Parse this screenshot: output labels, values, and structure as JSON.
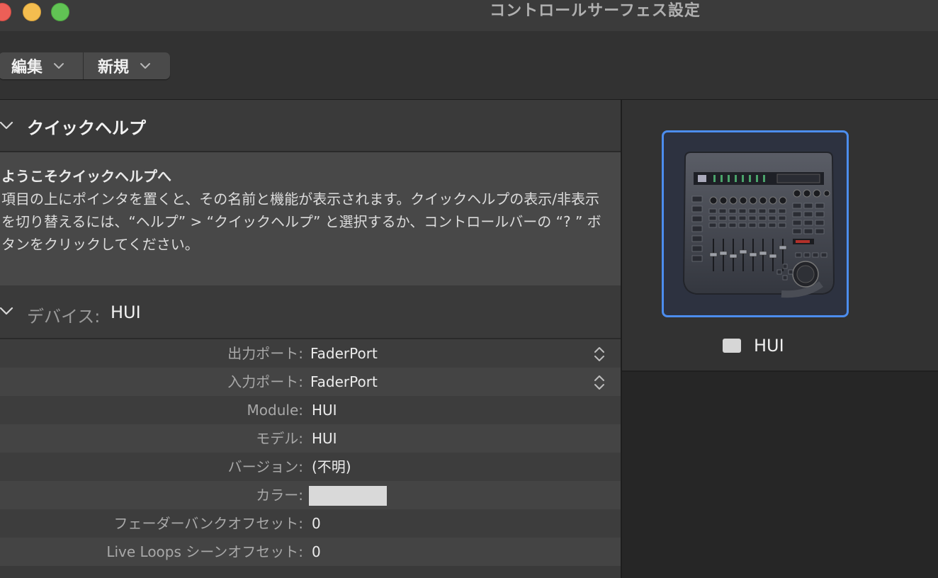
{
  "window": {
    "title": "コントロールサーフェス設定"
  },
  "toolbar": {
    "edit_label": "編集",
    "new_label": "新規"
  },
  "quick_help": {
    "title": "クイックヘルプ",
    "welcome": "ようこそクイックヘルプへ",
    "body": "項目の上にポインタを置くと、その名前と機能が表示されます。クイックヘルプの表示/非表示を切り替えるには、“ヘルプ” > “クイックヘルプ” と選択するか、コントロールバーの “? ” ボタンをクリックしてください。"
  },
  "device": {
    "section_label": "デバイス:",
    "name": "HUI",
    "properties": [
      {
        "label": "出力ポート:",
        "value": "FaderPort"
      },
      {
        "label": "入力ポート:",
        "value": "FaderPort"
      },
      {
        "label": "Module:",
        "value": "HUI"
      },
      {
        "label": "モデル:",
        "value": "HUI"
      },
      {
        "label": "バージョン:",
        "value": "(不明)"
      },
      {
        "label": "カラー:",
        "value": "",
        "color": "#d9d9d9"
      },
      {
        "label": "フェーダーバンクオフセット:",
        "value": "0"
      },
      {
        "label": "Live Loops シーンオフセット:",
        "value": "0"
      }
    ]
  },
  "surface_panel": {
    "device_label": "HUI",
    "selection_color": "#4c8dee"
  }
}
